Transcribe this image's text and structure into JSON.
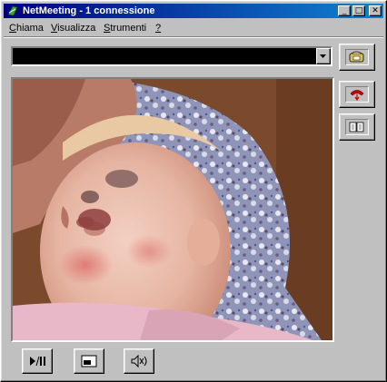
{
  "window": {
    "title": "NetMeeting - 1 connessione"
  },
  "titlebar_buttons": {
    "minimize": "_",
    "maximize": "□",
    "close": "✕"
  },
  "menu": {
    "items": [
      {
        "first": "C",
        "rest": "hiama"
      },
      {
        "first": "V",
        "rest": "isualizza"
      },
      {
        "first": "S",
        "rest": "trumenti"
      },
      {
        "first": "?",
        "rest": ""
      }
    ]
  },
  "address": {
    "value": ""
  },
  "icons": {
    "app": "netmeeting-icon",
    "place_call": "place-call-icon",
    "hang_up": "hang-up-icon",
    "directory": "directory-book-icon",
    "play_pause": "play-pause-icon",
    "picture_in_picture": "picture-in-picture-icon",
    "volume": "speaker-volume-icon"
  },
  "colors": {
    "titlebar_start": "#000080",
    "titlebar_end": "#1084d0",
    "face": "#c0c0c0",
    "hangup_red": "#cc0000"
  }
}
